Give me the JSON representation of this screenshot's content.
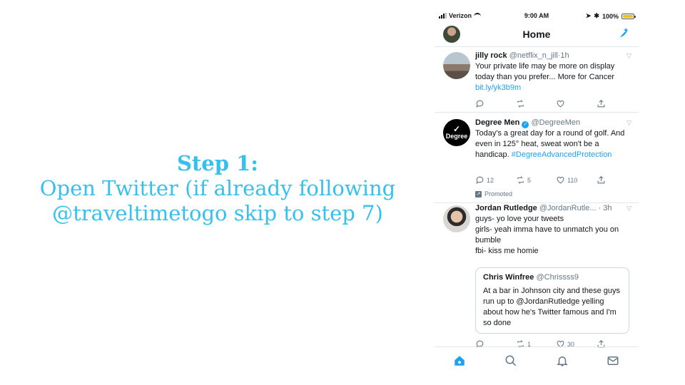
{
  "caption": {
    "step": "Step 1:",
    "line1": "Open Twitter (if already following",
    "line2": "@traveltimetogo skip to step 7)"
  },
  "status": {
    "carrier": "Verizon",
    "time": "9:00 AM",
    "battery": "100%",
    "battery_level": 1.0
  },
  "nav": {
    "title": "Home"
  },
  "icons": [
    "compose-tweet-icon",
    "reply-icon",
    "retweet-icon",
    "like-icon",
    "share-icon",
    "home-icon",
    "search-icon",
    "notifications-icon",
    "messages-icon",
    "verified-icon"
  ],
  "colors": {
    "accent": "#1da1f2",
    "caption": "#35c0ee",
    "muted": "#657786"
  },
  "tweets": [
    {
      "name": "jilly rock",
      "handle": "@netflix_n_jill",
      "time": "1h",
      "text": "Your private life may be more on display today than you prefer... More for Cancer",
      "link": "bit.ly/yk3b9m"
    },
    {
      "name": "Degree Men",
      "handle": "@DegreeMen",
      "avatar_text": "Degree",
      "text": "Today's a great day for a round of golf. And even in 125° heat, sweat won't be a handicap.",
      "hashtag": "#DegreeAdvancedProtection",
      "replies": "12",
      "retweets": "5",
      "likes": "110",
      "promoted": "Promoted"
    },
    {
      "name": "Jordan Rutledge",
      "handle": "@JordanRutle...",
      "time": "3h",
      "text": "guys- yo love your tweets\ngirls- yeah imma have to unmatch you on bumble\nfbi- kiss me homie",
      "quote": {
        "name": "Chris Winfree",
        "handle": "@Chrissss9",
        "text": "At a bar in Johnson city and these guys run up to @JordanRutledge yelling about how he's Twitter famous and I'm so done"
      },
      "retweets": "1",
      "likes": "30"
    }
  ]
}
